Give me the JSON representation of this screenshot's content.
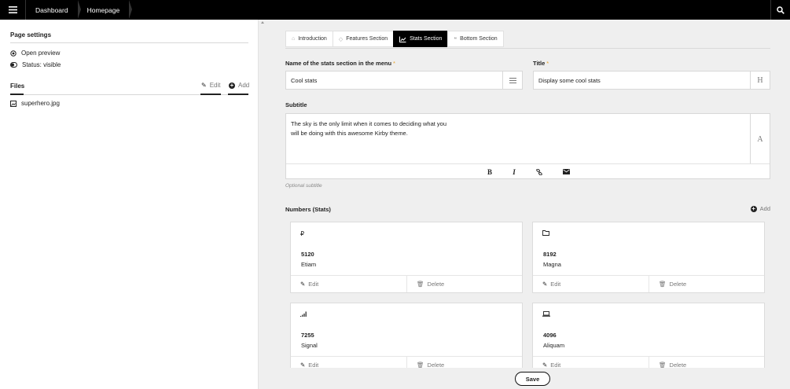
{
  "topbar": {
    "menu_icon": "hamburger-icon",
    "breadcrumbs": [
      "Dashboard",
      "Homepage"
    ],
    "search_icon": "search-icon"
  },
  "sidebar": {
    "page_settings_title": "Page settings",
    "open_preview": "Open preview",
    "status": "Status: visible",
    "files_title": "Files",
    "files_edit": "Edit",
    "files_add": "Add",
    "files": [
      "superhero.jpg"
    ]
  },
  "tabs": [
    {
      "label": "Introduction",
      "icon": "home-icon",
      "active": false
    },
    {
      "label": "Features Section",
      "icon": "diamond-icon",
      "active": false
    },
    {
      "label": "Stats Section",
      "icon": "chart-icon",
      "active": true
    },
    {
      "label": "Bottom Section",
      "icon": "quote-icon",
      "active": false
    }
  ],
  "form": {
    "menu_name_label": "Name of the stats section in the menu",
    "menu_name_value": "Cool stats",
    "title_label": "Title",
    "title_value": "Display some cool stats",
    "required_mark": "*",
    "subtitle_label": "Subtitle",
    "subtitle_line1": "The sky is the only limit when it comes to deciding what you",
    "subtitle_line2": "will be doing with this awesome Kirby theme.",
    "subtitle_help": "Optional subtitle",
    "toolbar": {
      "bold": "B",
      "italic": "I"
    }
  },
  "numbers": {
    "title": "Numbers (Stats)",
    "add_label": "Add",
    "edit_label": "Edit",
    "delete_label": "Delete",
    "items": [
      {
        "icon": "ruble-icon",
        "glyph": "₽",
        "value": "5120",
        "name": "Etiam"
      },
      {
        "icon": "folder-icon",
        "glyph": "🗀",
        "value": "8192",
        "name": "Magna"
      },
      {
        "icon": "signal-icon",
        "glyph": "",
        "value": "7255",
        "name": "Signal"
      },
      {
        "icon": "laptop-icon",
        "glyph": "",
        "value": "4096",
        "name": "Aliquam"
      }
    ]
  },
  "save_label": "Save"
}
